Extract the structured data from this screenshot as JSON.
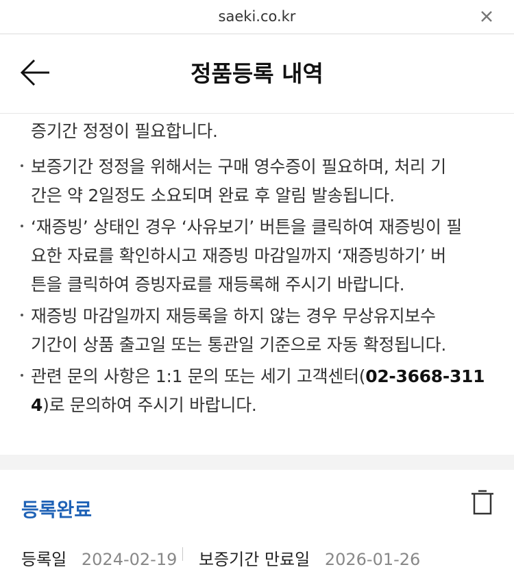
{
  "browser": {
    "url": "saeki.co.kr",
    "close_icon": "close-icon"
  },
  "header": {
    "title": "정품등록 내역",
    "back_icon": "arrow-left-icon"
  },
  "notice": {
    "line_0": "증기간 정정이 필요합니다.",
    "bullets": [
      {
        "lines": [
          "보증기간 정정을 위해서는 구매 영수증이 필요하며, 처리 기",
          "간은 약 2일정도 소요되며 완료 후 알림 발송됩니다."
        ]
      },
      {
        "lines": [
          "‘재증빙’ 상태인 경우 ‘사유보기’ 버튼을 클릭하여 재증빙이 필",
          "요한 자료를 확인하시고 재증빙 마감일까지 ‘재증빙하기’ 버",
          "튼을 클릭하여 증빙자료를 재등록해 주시기 바랍니다."
        ]
      },
      {
        "lines": [
          "재증빙 마감일까지 재등록을 하지 않는 경우 무상유지보수",
          "기간이 상품 출고일 또는 통관일 기준으로 자동 확정됩니다."
        ]
      },
      {
        "line_a": "관련 문의 사항은 1:1 문의 또는 세기 고객센터(",
        "phone_a": "02-3668-311",
        "phone_b": "4",
        "line_b": ")로 문의하여 주시기 바랍니다."
      }
    ]
  },
  "card": {
    "status": "등록완료",
    "delete_icon": "trash-icon",
    "registered_label": "등록일",
    "registered_value": "2024-02-19",
    "warranty_label": "보증기간 만료일",
    "warranty_value": "2026-01-26"
  }
}
